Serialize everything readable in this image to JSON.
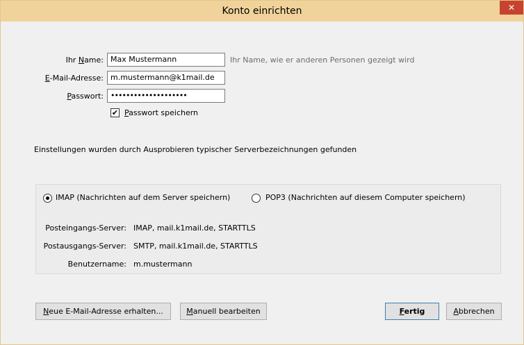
{
  "window": {
    "title": "Konto einrichten"
  },
  "account": {
    "name": {
      "label_prefix": "Ihr ",
      "label_ul": "N",
      "label_suffix": "ame:",
      "value": "Max Mustermann",
      "hint": "Ihr Name, wie er anderen Personen gezeigt wird"
    },
    "email": {
      "label_prefix": "",
      "label_ul": "E",
      "label_suffix": "-Mail-Adresse:",
      "value": "m.mustermann@k1mail.de"
    },
    "password": {
      "label_prefix": "",
      "label_ul": "P",
      "label_suffix": "asswort:",
      "value": "••••••••••••••••••••"
    },
    "remember": {
      "checked": "✔",
      "label_ul": "P",
      "label_suffix": "asswort speichern"
    }
  },
  "status": "Einstellungen wurden durch Ausprobieren typischer Serverbezeichnungen gefunden",
  "protocol": {
    "imap_label": "IMAP (Nachrichten auf dem Server speichern)",
    "pop3_label": "POP3 (Nachrichten auf diesem Computer speichern)"
  },
  "servers": {
    "incoming_label": "Posteingangs-Server:",
    "incoming_value": "IMAP, mail.k1mail.de, STARTTLS",
    "outgoing_label": "Postausgangs-Server:",
    "outgoing_value": "SMTP, mail.k1mail.de, STARTTLS",
    "user_label": "Benutzername:",
    "user_value": "m.mustermann"
  },
  "buttons": {
    "new_email_ul": "N",
    "new_email_rest": "eue E-Mail-Adresse erhalten...",
    "manual_ul": "M",
    "manual_rest": "anuell bearbeiten",
    "done_ul": "F",
    "done_rest": "ertig",
    "cancel_ul": "A",
    "cancel_rest": "bbrechen"
  },
  "icons": {
    "close": "close-icon",
    "check": "check-icon"
  }
}
